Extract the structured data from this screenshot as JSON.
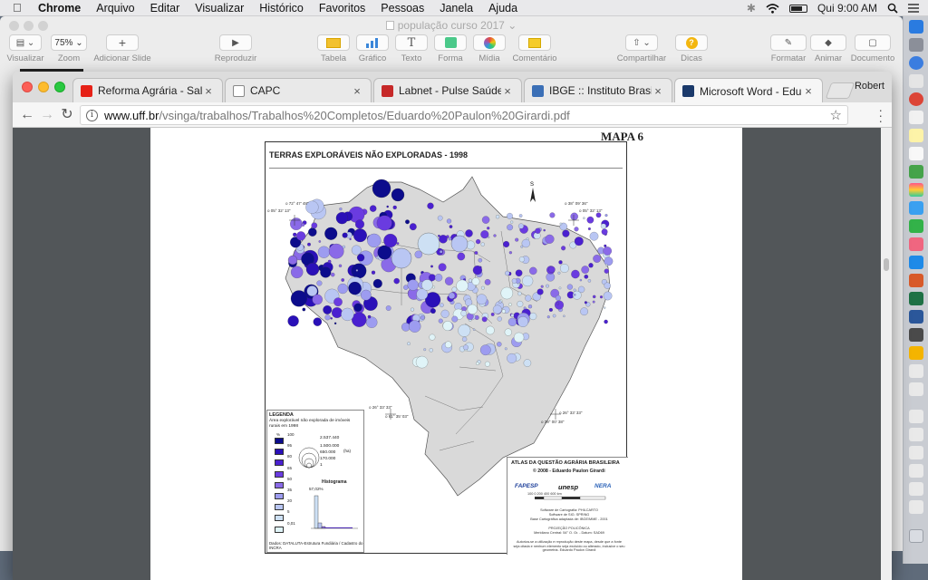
{
  "menubar": {
    "app": "Chrome",
    "items": [
      "Arquivo",
      "Editar",
      "Visualizar",
      "Histórico",
      "Favoritos",
      "Pessoas",
      "Janela",
      "Ajuda"
    ],
    "clock": "Qui 9:00 AM"
  },
  "keynote": {
    "document_title": "população curso 2017",
    "toolbar": {
      "visualizar": "Visualizar",
      "zoom_value": "75%",
      "zoom": "Zoom",
      "add_slide": "Adicionar Slide",
      "play": "Reproduzir",
      "tabela": "Tabela",
      "grafico": "Gráfico",
      "texto": "Texto",
      "forma": "Forma",
      "midia": "Mídia",
      "comentario": "Comentário",
      "compartilhar": "Compartilhar",
      "dicas": "Dicas",
      "formatar": "Formatar",
      "animar": "Animar",
      "documento": "Documento"
    }
  },
  "chrome": {
    "tabs": [
      {
        "title": "Reforma Agrária - Sala Del",
        "color": "#e62117"
      },
      {
        "title": "CAPC",
        "color": "#888888"
      },
      {
        "title": "Labnet - Pulse Saúde",
        "color": "#c62828"
      },
      {
        "title": "IBGE :: Instituto Brasileiro d",
        "color": "#3b6fb6"
      },
      {
        "title": "Microsoft Word - Eduardo P",
        "color": "#1b3a6b"
      }
    ],
    "profile": "Robert",
    "url_host": "www.uff.br",
    "url_path": "/vsinga/trabalhos/Trabalhos%20Completos/Eduardo%20Paulon%20Girardi.pdf"
  },
  "pdf": {
    "map_label": "MAPA 6",
    "map_title": "TERRAS EXPLORÁVEIS NÃO EXPLORADAS - 1998",
    "north": "S",
    "coords": {
      "nw1": "o 72° 47' 48\"",
      "nw2": "o 05° 32' 13\"",
      "ne1": "o 38° 09' 36\"",
      "ne2": "o 05° 32' 13\"",
      "sw1": "o 26° 33' 33\"",
      "sw2": "o 61° 35' 03\"",
      "se1": "o 26° 33' 33\"",
      "se2": "o 39° 00' 38\""
    },
    "legend": {
      "heading": "LEGENDA",
      "subtitle": "Área explorável não explorada de imóveis rurais em 1998",
      "pct_symbol": "%",
      "classes": [
        "100",
        "95",
        "80",
        "65",
        "50",
        "35",
        "20",
        "5",
        "0,01"
      ],
      "class_colors": [
        "#0c0c8c",
        "#2a10b8",
        "#4a20d0",
        "#6a3be0",
        "#8a6ae8",
        "#9d9cf0",
        "#b9c6f3",
        "#cde0f4",
        "#e0f4f8"
      ],
      "sizes": [
        "2.537.440",
        "1.500.000",
        "650.000",
        "170.000",
        "1"
      ],
      "size_unit": "(ha)",
      "histogram_title": "Histograma",
      "histogram_pct": "57,02%",
      "dados": "Dados: DATALUTA-Estrutura Fundiária / Cadastro do INCRA"
    },
    "atlas": {
      "title": "ATLAS DA QUESTÃO AGRÁRIA BRASILEIRA",
      "author": "© 2008 - Eduardo Paulon Girardi",
      "logos": [
        "FAPESP",
        "unesp",
        "NERA"
      ],
      "scale": "100  0     200    400      600 km",
      "software": "Software de Cartografia: PHILCARTO",
      "sig": "Software de SIG: SPRING",
      "base": "Base Cartográfica adaptada de: IBGE/MME - 2001",
      "projection": "PROJEÇÃO POLICÔNICA",
      "meridian": "Meridiano Central: 54° O. Gr. - Datum: SAD69",
      "notice": "Autoriza-se a utilização e reprodução deste mapa, desde que a fonte seja citada e nenhum elemento seja excluído ou alterado, inclusive o seu geometria. Eduardo Paulon Girardi"
    }
  }
}
